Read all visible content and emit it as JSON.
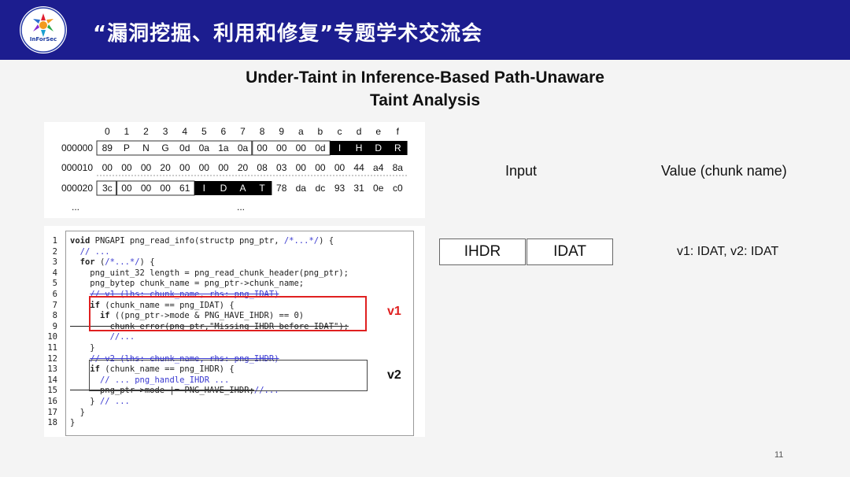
{
  "header": {
    "title": "“漏洞挖掘、利用和修复”专题学术交流会",
    "logo_text": "InForSec"
  },
  "slide": {
    "title_line1": "Under-Taint in Inference-Based Path-Unaware",
    "title_line2": "Taint Analysis",
    "page_number": "11"
  },
  "hexdump": {
    "columns": [
      "0",
      "1",
      "2",
      "3",
      "4",
      "5",
      "6",
      "7",
      "8",
      "9",
      "a",
      "b",
      "c",
      "d",
      "e",
      "f"
    ],
    "rows": [
      {
        "offset": "000000",
        "bytes": [
          "89",
          "P",
          "N",
          "G",
          "0d",
          "0a",
          "1a",
          "0a",
          "00",
          "00",
          "00",
          "0d",
          "I",
          "H",
          "D",
          "R"
        ]
      },
      {
        "offset": "000010",
        "bytes": [
          "00",
          "00",
          "00",
          "20",
          "00",
          "00",
          "00",
          "20",
          "08",
          "03",
          "00",
          "00",
          "00",
          "44",
          "a4",
          "8a"
        ]
      },
      {
        "offset": "000020",
        "bytes": [
          "3c",
          "00",
          "00",
          "00",
          "61",
          "I",
          "D",
          "A",
          "T",
          "78",
          "da",
          "dc",
          "93",
          "31",
          "0e",
          "c0"
        ]
      }
    ],
    "ellipsis_left": "...",
    "ellipsis_mid": "..."
  },
  "code": {
    "lines": [
      {
        "n": "1",
        "parts": [
          {
            "t": "void",
            "c": "kw"
          },
          {
            "t": " PNGAPI png_read_info(structp png_ptr, ",
            "c": ""
          },
          {
            "t": "/*...*/",
            "c": "cm"
          },
          {
            "t": ") {",
            "c": ""
          }
        ]
      },
      {
        "n": "2",
        "parts": [
          {
            "t": "  ",
            "c": ""
          },
          {
            "t": "// ...",
            "c": "cm"
          }
        ]
      },
      {
        "n": "3",
        "parts": [
          {
            "t": "  ",
            "c": ""
          },
          {
            "t": "for",
            "c": "kw"
          },
          {
            "t": " (",
            "c": ""
          },
          {
            "t": "/*...*/",
            "c": "cm"
          },
          {
            "t": ") {",
            "c": ""
          }
        ]
      },
      {
        "n": "4",
        "parts": [
          {
            "t": "    png_uint_32 length = png_read_chunk_header(png_ptr);",
            "c": ""
          }
        ]
      },
      {
        "n": "5",
        "parts": [
          {
            "t": "    png_bytep chunk_name = png_ptr->chunk_name;",
            "c": ""
          }
        ]
      },
      {
        "n": "6",
        "parts": [
          {
            "t": "    ",
            "c": ""
          },
          {
            "t": "// v1 (lhs: chunk_name, rhs: png_IDAT)",
            "c": "cm-strike"
          }
        ]
      },
      {
        "n": "7",
        "parts": [
          {
            "t": "    ",
            "c": ""
          },
          {
            "t": "if",
            "c": "kw"
          },
          {
            "t": " (chunk_name == png_IDAT) {",
            "c": ""
          }
        ]
      },
      {
        "n": "8",
        "parts": [
          {
            "t": "      ",
            "c": ""
          },
          {
            "t": "if",
            "c": "kw"
          },
          {
            "t": " ((png_ptr->mode & PNG_HAVE_IHDR) == 0)",
            "c": ""
          }
        ]
      },
      {
        "n": "9",
        "parts": [
          {
            "t": "        chunk_error(png_ptr,\"Missing IHDR before IDAT\");",
            "c": "strike"
          }
        ]
      },
      {
        "n": "10",
        "parts": [
          {
            "t": "        ",
            "c": ""
          },
          {
            "t": "//...",
            "c": "cm"
          }
        ]
      },
      {
        "n": "11",
        "parts": [
          {
            "t": "    }",
            "c": ""
          }
        ]
      },
      {
        "n": "12",
        "parts": [
          {
            "t": "    ",
            "c": ""
          },
          {
            "t": "// v2 (lhs: chunk_name, rhs: png_IHDR)",
            "c": "cm-strike"
          }
        ]
      },
      {
        "n": "13",
        "parts": [
          {
            "t": "    ",
            "c": ""
          },
          {
            "t": "if",
            "c": "kw"
          },
          {
            "t": " (chunk_name == png_IHDR) {",
            "c": ""
          }
        ]
      },
      {
        "n": "14",
        "parts": [
          {
            "t": "      ",
            "c": ""
          },
          {
            "t": "// ... png_handle_IHDR ...",
            "c": "cm"
          }
        ]
      },
      {
        "n": "15",
        "parts": [
          {
            "t": "      png_ptr->mode |= PNG_HAVE_IHDR;",
            "c": "strike"
          },
          {
            "t": "//...",
            "c": "cm"
          }
        ]
      },
      {
        "n": "16",
        "parts": [
          {
            "t": "    } ",
            "c": ""
          },
          {
            "t": "// ...",
            "c": "cm"
          }
        ]
      },
      {
        "n": "17",
        "parts": [
          {
            "t": "  }",
            "c": ""
          }
        ]
      },
      {
        "n": "18",
        "parts": [
          {
            "t": "}",
            "c": ""
          }
        ]
      }
    ],
    "label_v1": "v1",
    "label_v2": "v2"
  },
  "table": {
    "input_header": "Input",
    "value_header": "Value (chunk name)",
    "inputs": [
      "IHDR",
      "IDAT"
    ],
    "value": "v1: IDAT, v2: IDAT"
  }
}
